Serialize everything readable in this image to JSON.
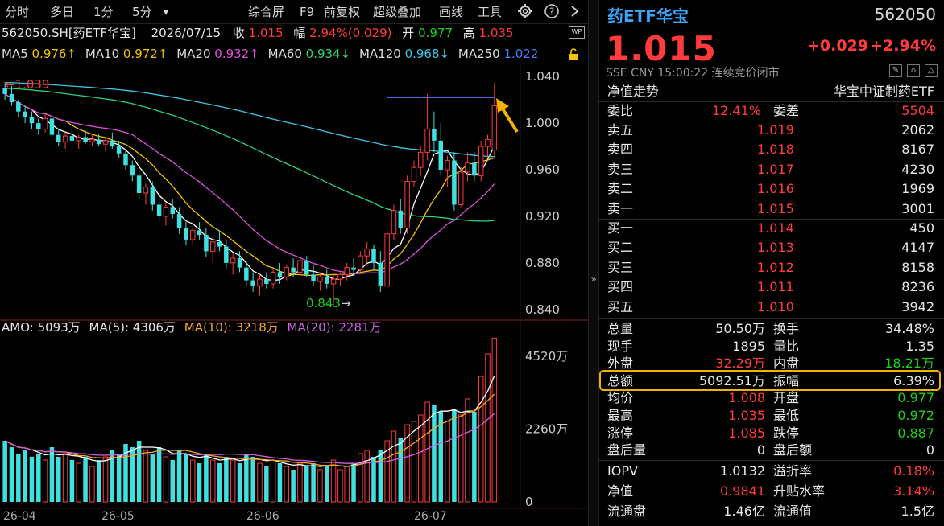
{
  "toolbar": {
    "items": [
      "分时",
      "多日",
      "1分",
      "5分",
      "综合屏",
      "F9",
      "前复权",
      "超级叠加",
      "画线",
      "工具"
    ],
    "dropdown_glyph": "▾",
    "settings_icon": "gear-icon",
    "help_icon": "help-icon",
    "close_icon": "chevron-right-icon"
  },
  "info": {
    "code_name": "562050.SH[药ETF华宝]",
    "date": "2026/07/15",
    "close_label": "收",
    "close_value": "1.015",
    "range_label": "幅",
    "range_value": "2.94%(0.029)",
    "open_label": "开",
    "open_value": "0.977",
    "high_label": "高",
    "high_value": "1.035"
  },
  "ma": [
    {
      "label": "MA5",
      "value": "0.976↑",
      "color": "#f5c400"
    },
    {
      "label": "MA10",
      "value": "0.972↑",
      "color": "#f5c400"
    },
    {
      "label": "MA20",
      "value": "0.932↑",
      "color": "#e050e0"
    },
    {
      "label": "MA60",
      "value": "0.934↓",
      "color": "#2bd47a"
    },
    {
      "label": "MA120",
      "value": "0.968↓",
      "color": "#3fc6e6"
    },
    {
      "label": "MA250",
      "value": "1.022",
      "color": "#4a7bff"
    }
  ],
  "chart": {
    "y_ticks": [
      "1.040",
      "1.000",
      "0.960",
      "0.920",
      "0.880",
      "0.840"
    ],
    "max_label": "1.039",
    "min_label": "0.843",
    "vol_header": {
      "amo": "AMO: 5093万",
      "ma5": "MA(5): 4306万",
      "ma10": "MA(10): 3218万",
      "ma20": "MA(20): 2281万"
    },
    "vol_ticks": [
      "4520万",
      "2260万",
      "0"
    ],
    "x_labels": [
      "26-04",
      "26-05",
      "26-06",
      "26-07"
    ]
  },
  "chart_data": {
    "type": "candlestick",
    "title": "562050.SH 药ETF华宝",
    "price_ylim": [
      0.835,
      1.045
    ],
    "volume_ylim": [
      0,
      5100
    ],
    "volume_unit": "万",
    "candles": [
      [
        1.03,
        1.035,
        1.02,
        1.025,
        1900
      ],
      [
        1.025,
        1.032,
        1.015,
        1.018,
        1700
      ],
      [
        1.018,
        1.02,
        1.005,
        1.01,
        1500
      ],
      [
        1.01,
        1.015,
        1.0,
        1.005,
        1600
      ],
      [
        1.005,
        1.01,
        0.995,
        1.0,
        1400
      ],
      [
        1.0,
        1.004,
        0.99,
        0.995,
        1500
      ],
      [
        0.995,
        1.008,
        0.992,
        1.004,
        1300
      ],
      [
        1.004,
        1.006,
        0.985,
        0.99,
        1700
      ],
      [
        0.99,
        0.995,
        0.98,
        0.984,
        1400
      ],
      [
        0.984,
        0.992,
        0.978,
        0.989,
        1500
      ],
      [
        0.989,
        0.996,
        0.983,
        0.985,
        1300
      ],
      [
        0.985,
        0.99,
        0.978,
        0.988,
        1200
      ],
      [
        0.988,
        0.994,
        0.982,
        0.984,
        1400
      ],
      [
        0.984,
        0.99,
        0.98,
        0.986,
        1100
      ],
      [
        0.986,
        0.991,
        0.98,
        0.982,
        1300
      ],
      [
        0.982,
        0.988,
        0.975,
        0.985,
        1400
      ],
      [
        0.985,
        0.992,
        0.978,
        0.98,
        1600
      ],
      [
        0.98,
        0.985,
        0.97,
        0.974,
        1500
      ],
      [
        0.974,
        0.978,
        0.96,
        0.964,
        1800
      ],
      [
        0.964,
        0.968,
        0.95,
        0.955,
        1700
      ],
      [
        0.955,
        0.96,
        0.935,
        0.94,
        1900
      ],
      [
        0.94,
        0.948,
        0.93,
        0.945,
        1600
      ],
      [
        0.945,
        0.95,
        0.925,
        0.93,
        1500
      ],
      [
        0.93,
        0.935,
        0.915,
        0.92,
        1700
      ],
      [
        0.92,
        0.932,
        0.912,
        0.928,
        1400
      ],
      [
        0.928,
        0.935,
        0.918,
        0.922,
        1300
      ],
      [
        0.922,
        0.928,
        0.905,
        0.91,
        1600
      ],
      [
        0.91,
        0.915,
        0.895,
        0.9,
        1500
      ],
      [
        0.9,
        0.912,
        0.895,
        0.908,
        1300
      ],
      [
        0.908,
        0.915,
        0.9,
        0.904,
        1200
      ],
      [
        0.904,
        0.91,
        0.885,
        0.89,
        1500
      ],
      [
        0.89,
        0.902,
        0.88,
        0.898,
        1300
      ],
      [
        0.898,
        0.908,
        0.89,
        0.894,
        1200
      ],
      [
        0.894,
        0.9,
        0.875,
        0.88,
        1400
      ],
      [
        0.88,
        0.888,
        0.87,
        0.884,
        1300
      ],
      [
        0.884,
        0.89,
        0.872,
        0.876,
        1200
      ],
      [
        0.876,
        0.882,
        0.86,
        0.865,
        1500
      ],
      [
        0.865,
        0.872,
        0.855,
        0.86,
        1400
      ],
      [
        0.86,
        0.87,
        0.852,
        0.866,
        1200
      ],
      [
        0.866,
        0.872,
        0.858,
        0.862,
        1100
      ],
      [
        0.862,
        0.875,
        0.858,
        0.872,
        1300
      ],
      [
        0.872,
        0.88,
        0.862,
        0.868,
        1200
      ],
      [
        0.868,
        0.878,
        0.865,
        0.876,
        1100
      ],
      [
        0.876,
        0.884,
        0.868,
        0.872,
        1000
      ],
      [
        0.872,
        0.885,
        0.87,
        0.882,
        1200
      ],
      [
        0.882,
        0.886,
        0.868,
        0.87,
        1100
      ],
      [
        0.87,
        0.878,
        0.86,
        0.864,
        1200
      ],
      [
        0.864,
        0.872,
        0.856,
        0.868,
        1000
      ],
      [
        0.868,
        0.874,
        0.858,
        0.862,
        1100
      ],
      [
        0.862,
        0.87,
        0.843,
        0.866,
        1300
      ],
      [
        0.866,
        0.872,
        0.86,
        0.87,
        1000
      ],
      [
        0.87,
        0.88,
        0.865,
        0.876,
        1100
      ],
      [
        0.876,
        0.884,
        0.87,
        0.874,
        1200
      ],
      [
        0.874,
        0.89,
        0.872,
        0.886,
        1500
      ],
      [
        0.886,
        0.898,
        0.88,
        0.892,
        1600
      ],
      [
        0.892,
        0.896,
        0.875,
        0.88,
        1400
      ],
      [
        0.88,
        0.89,
        0.855,
        0.86,
        1600
      ],
      [
        0.86,
        0.91,
        0.858,
        0.905,
        1900
      ],
      [
        0.905,
        0.93,
        0.9,
        0.925,
        2200
      ],
      [
        0.925,
        0.935,
        0.905,
        0.91,
        2000
      ],
      [
        0.91,
        0.955,
        0.905,
        0.95,
        2400
      ],
      [
        0.95,
        0.968,
        0.945,
        0.962,
        2500
      ],
      [
        0.962,
        0.98,
        0.955,
        0.975,
        2700
      ],
      [
        0.975,
        1.025,
        0.968,
        0.995,
        3100
      ],
      [
        0.995,
        1.01,
        0.975,
        0.985,
        3000
      ],
      [
        0.985,
        1.0,
        0.955,
        0.96,
        2800
      ],
      [
        0.96,
        0.972,
        0.945,
        0.968,
        2500
      ],
      [
        0.968,
        0.975,
        0.925,
        0.93,
        2900
      ],
      [
        0.93,
        0.962,
        0.928,
        0.958,
        2700
      ],
      [
        0.958,
        0.975,
        0.95,
        0.966,
        3200
      ],
      [
        0.966,
        0.975,
        0.95,
        0.955,
        2800
      ],
      [
        0.955,
        0.985,
        0.95,
        0.98,
        3900
      ],
      [
        0.98,
        0.99,
        0.97,
        0.986,
        4600
      ],
      [
        0.977,
        1.035,
        0.972,
        1.015,
        5093
      ]
    ]
  },
  "panel": {
    "name": "药ETF华宝",
    "code": "562050",
    "price": "1.015",
    "change": "+0.029",
    "change_pct": "+2.94%",
    "sub": "SSE  CNY  15:00:22  连续竞价闭市",
    "nav_label": "净值走势",
    "index_name": "华宝中证制药ETF",
    "weibi_label": "委比",
    "weibi_value": "12.41%",
    "weicha_label": "委差",
    "weicha_value": "5504",
    "asks": [
      {
        "label": "卖五",
        "price": "1.019",
        "vol": "2062"
      },
      {
        "label": "卖四",
        "price": "1.018",
        "vol": "8167"
      },
      {
        "label": "卖三",
        "price": "1.017",
        "vol": "4230"
      },
      {
        "label": "卖二",
        "price": "1.016",
        "vol": "1969"
      },
      {
        "label": "卖一",
        "price": "1.015",
        "vol": "3001"
      }
    ],
    "bids": [
      {
        "label": "买一",
        "price": "1.014",
        "vol": "450"
      },
      {
        "label": "买二",
        "price": "1.013",
        "vol": "4147"
      },
      {
        "label": "买三",
        "price": "1.012",
        "vol": "8158"
      },
      {
        "label": "买四",
        "price": "1.011",
        "vol": "8236"
      },
      {
        "label": "买五",
        "price": "1.010",
        "vol": "3942"
      }
    ],
    "stats": [
      {
        "l1": "总量",
        "v1": "50.50万",
        "c1": "white",
        "l2": "换手",
        "v2": "34.48%",
        "c2": "white"
      },
      {
        "l1": "现手",
        "v1": "1895",
        "c1": "white",
        "l2": "量比",
        "v2": "1.35",
        "c2": "white"
      },
      {
        "l1": "外盘",
        "v1": "32.29万",
        "c1": "red",
        "l2": "内盘",
        "v2": "18.21万",
        "c2": "green"
      },
      {
        "l1": "总额",
        "v1": "5092.51万",
        "c1": "white",
        "l2": "振幅",
        "v2": "6.39%",
        "c2": "white"
      },
      {
        "l1": "均价",
        "v1": "1.008",
        "c1": "red",
        "l2": "开盘",
        "v2": "0.977",
        "c2": "green"
      },
      {
        "l1": "最高",
        "v1": "1.035",
        "c1": "red",
        "l2": "最低",
        "v2": "0.972",
        "c2": "green"
      },
      {
        "l1": "涨停",
        "v1": "1.085",
        "c1": "red",
        "l2": "跌停",
        "v2": "0.887",
        "c2": "green"
      },
      {
        "l1": "盘后量",
        "v1": "0",
        "c1": "white",
        "l2": "盘后额",
        "v2": "0",
        "c2": "white"
      }
    ],
    "extra": [
      {
        "l1": "IOPV",
        "v1": "1.0132",
        "c1": "white",
        "l2": "溢折率",
        "v2": "0.18%",
        "c2": "red"
      },
      {
        "l1": "净值",
        "v1": "0.9841",
        "c1": "red",
        "l2": "升贴水率",
        "v2": "3.14%",
        "c2": "red"
      },
      {
        "l1": "流通盘",
        "v1": "1.46亿",
        "c1": "white",
        "l2": "流通值",
        "v2": "1.5亿",
        "c2": "white"
      }
    ]
  }
}
